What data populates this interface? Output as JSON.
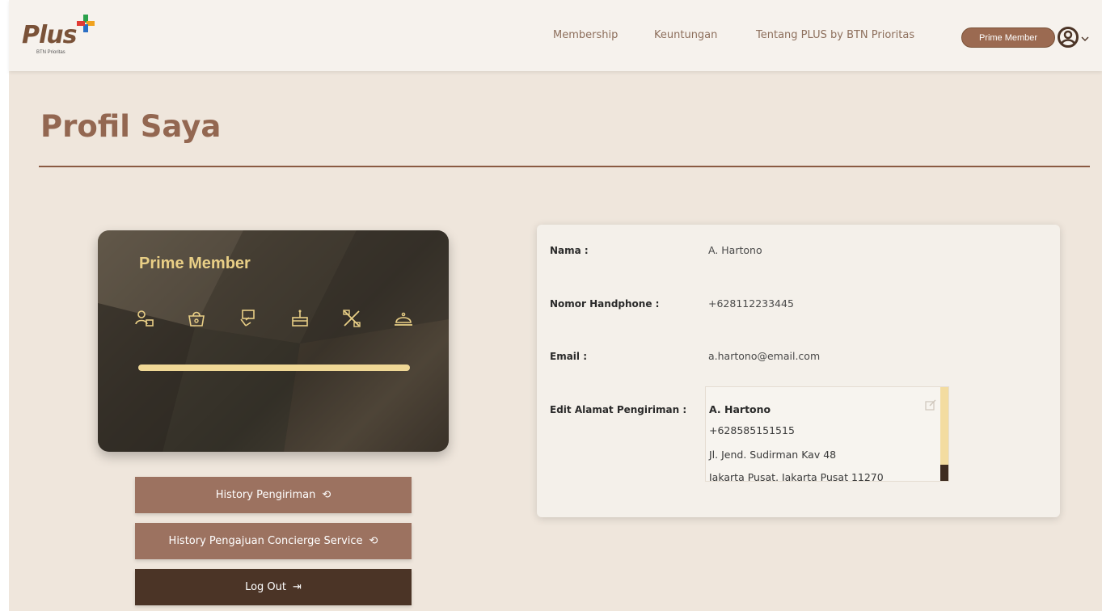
{
  "nav": {
    "brand": "Plus",
    "brand_sub": "BTN Prioritas",
    "links": [
      "Membership",
      "Keuntungan",
      "Tentang PLUS by BTN Prioritas"
    ],
    "member_badge": "Prime Member",
    "user_icon": "user-circle-icon"
  },
  "page": {
    "title": "Profil Saya"
  },
  "card": {
    "title": "Prime Member",
    "icons": [
      "users-icon",
      "shopping-bag-icon",
      "ticket-hand-icon",
      "cake-icon",
      "dining-icon",
      "cloche-icon"
    ]
  },
  "buttons": {
    "history_shipping": "History Pengiriman",
    "history_concierge": "History Pengajuan Concierge Service",
    "logout": "Log Out"
  },
  "profile": {
    "name_label": "Nama :",
    "name_value": "A. Hartono",
    "phone_label": "Nomor Handphone :",
    "phone_value": "+628112233445",
    "email_label": "Email :",
    "email_value": "a.hartono@email.com",
    "address_label": "Edit Alamat Pengiriman :",
    "address": {
      "name": "A. Hartono",
      "phone": "+628585151515",
      "line1": "Jl. Jend. Sudirman Kav 48",
      "line2": "Jakarta Pusat, Jakarta Pusat 11270"
    }
  },
  "colors": {
    "brand_brown": "#936751",
    "card_gold": "#e9cf86",
    "page_bg": "#efe6dc",
    "button_brown": "#9c7260",
    "button_dark": "#4b3426"
  }
}
